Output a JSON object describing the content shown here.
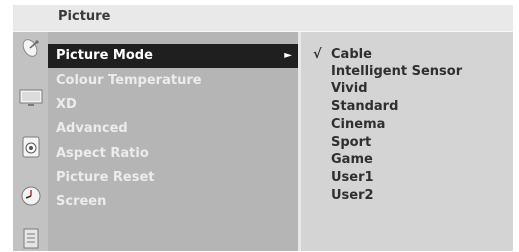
{
  "header": {
    "title": "Picture"
  },
  "sidebar": {
    "icons": [
      "satellite-dish-icon",
      "tv-icon",
      "speaker-icon",
      "clock-icon",
      "lock-icon"
    ]
  },
  "menu": {
    "items": [
      {
        "label": "Picture Mode",
        "selected": true,
        "arrow": "►"
      },
      {
        "label": "Colour Temperature"
      },
      {
        "label": "XD"
      },
      {
        "label": "Advanced"
      },
      {
        "label": "Aspect Ratio"
      },
      {
        "label": "Picture Reset"
      },
      {
        "label": "Screen"
      }
    ]
  },
  "options": {
    "check_mark": "√",
    "checked_index": 0,
    "items": [
      "Cable",
      "Intelligent Sensor",
      "Vivid",
      "Standard",
      "Cinema",
      "Sport",
      "Game",
      "User1",
      "User2"
    ]
  },
  "colors": {
    "selected_bg": "#1f1f1f",
    "menu_panel": "#b5b5b5",
    "options_panel": "#d4d4d4",
    "icon_bar": "#c2c2c2"
  }
}
